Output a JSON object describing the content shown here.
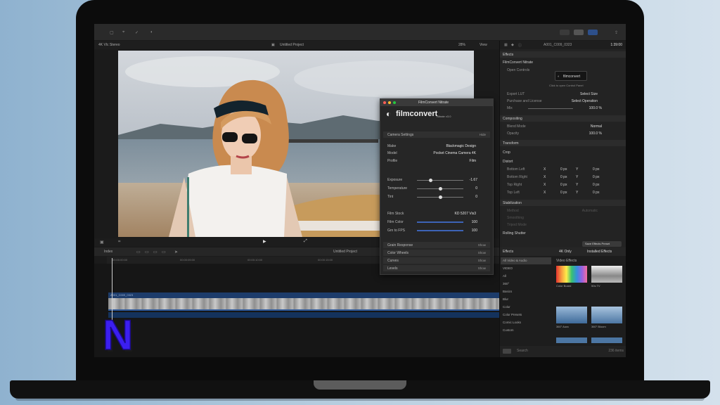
{
  "viewer": {
    "library": "4K Vlc Stereo",
    "project": "Untitled Project",
    "zoom": "28%",
    "view": "View"
  },
  "timeline": {
    "index": "Index",
    "project": "Untitled Project",
    "ruler": [
      "00:00:00:00",
      "00:00:05:00",
      "00:00:10:00",
      "00:00:15:00"
    ],
    "clip_name": "A001_C009_0323"
  },
  "inspector": {
    "clip_name": "A001_C009_0323",
    "timecode": "1:39:00",
    "effects_header": "Effects",
    "plugin": "FilmConvert Nitrate",
    "open_controls": "Open Controls",
    "fc_button": "filmconvert",
    "fc_button_caption": "Click to open Control Panel",
    "export_lut": "Export LUT",
    "export_lut_value": "Select Size",
    "purchase": "Purchase and License",
    "purchase_value": "Select Operation",
    "mix": "Mix",
    "mix_value": "100.0 %",
    "compositing": "Compositing",
    "blend_mode": "Blend Mode",
    "blend_value": "Normal",
    "opacity": "Opacity",
    "opacity_value": "100.0 %",
    "transform": "Transform",
    "crop": "Crop",
    "distort": "Distort",
    "bottom_left": "Bottom Left",
    "bottom_right": "Bottom Right",
    "top_right": "Top Right",
    "top_left": "Top Left",
    "x": "X",
    "y": "Y",
    "zero_px": "0 px",
    "stabilization": "Stabilization",
    "method": "Method",
    "method_value": "Automatic",
    "smoothing": "Smoothing",
    "tripod": "Tripod Mode",
    "rolling_shutter": "Rolling Shutter",
    "save_preset": "Save Effects Preset"
  },
  "effects_browser": {
    "header": "Effects",
    "only_4k": "4K Only",
    "installed": "Installed Effects",
    "categories": [
      "All Video & Audio",
      "VIDEO",
      "All",
      "360°",
      "Basics",
      "Blur",
      "Color",
      "Color Presets",
      "Comic Looks",
      "Custom"
    ],
    "section": "Video Effects",
    "thumbs": [
      "Color Board",
      "50s TV",
      "360° Aura",
      "360° Bloom"
    ],
    "search": "Search",
    "count": "236 items"
  },
  "filmconvert": {
    "title": "FilmConvert Nitrate",
    "logo": "filmconvert",
    "logo_sub": "Nitrate v3.0",
    "camera_settings": "Camera Settings",
    "hide": "Hide",
    "make": "Make",
    "make_value": "Blackmagic Design",
    "model": "Model",
    "model_value": "Pocket Cinema Camera 4K",
    "profile": "Profile",
    "profile_value": "Film",
    "exposure": "Exposure",
    "exposure_value": "-1.67",
    "temperature": "Temperature",
    "temperature_value": "0",
    "tint": "Tint",
    "tint_value": "0",
    "film_stock": "Film Stock",
    "film_stock_value": "KD 5207 Vis3",
    "film_color": "Film Color",
    "film_color_value": "100",
    "grain_pct": "Grn to FPS",
    "grain_pct_value": "100",
    "grain_response": "Grain Response",
    "color_wheels": "Color Wheels",
    "curves": "Curves",
    "levels": "Levels",
    "show": "Show"
  },
  "sliders": {
    "exposure": 0.3,
    "temperature": 0.5,
    "tint": 0.5,
    "film_color": 1.0,
    "grain": 1.0
  },
  "watermark": "N"
}
